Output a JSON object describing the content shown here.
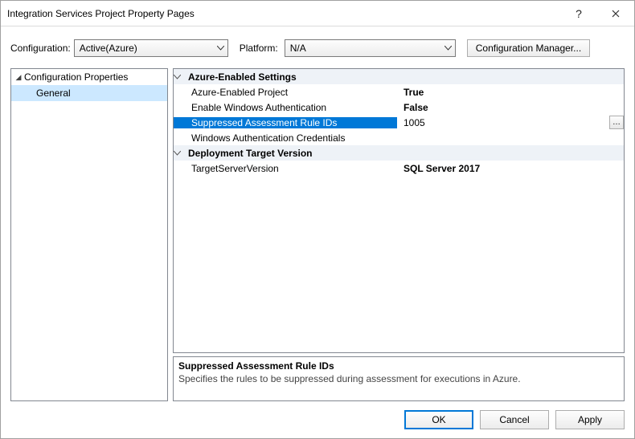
{
  "window": {
    "title": "Integration Services Project Property Pages"
  },
  "titlebar": {
    "help_icon": "?",
    "close_icon": "✕"
  },
  "config_row": {
    "config_label": "Configuration:",
    "config_value": "Active(Azure)",
    "platform_label": "Platform:",
    "platform_value": "N/A",
    "manager_button": "Configuration Manager..."
  },
  "tree": {
    "root": "Configuration Properties",
    "children": [
      "General"
    ]
  },
  "property_grid": {
    "categories": [
      {
        "name": "Azure-Enabled Settings",
        "expanded": true,
        "rows": [
          {
            "name": "Azure-Enabled Project",
            "value": "True",
            "bold_value": true
          },
          {
            "name": "Enable Windows Authentication",
            "value": "False",
            "bold_value": true
          },
          {
            "name": "Suppressed Assessment Rule IDs",
            "value": "1005",
            "selected": true,
            "has_ellipsis": true
          },
          {
            "name": "Windows Authentication Credentials",
            "value": ""
          }
        ]
      },
      {
        "name": "Deployment Target Version",
        "expanded": true,
        "rows": [
          {
            "name": "TargetServerVersion",
            "value": "SQL Server 2017",
            "bold_value": true
          }
        ]
      }
    ]
  },
  "description": {
    "title": "Suppressed Assessment Rule IDs",
    "text": "Specifies the rules to be suppressed during assessment for executions in Azure."
  },
  "buttons": {
    "ok": "OK",
    "cancel": "Cancel",
    "apply": "Apply"
  }
}
